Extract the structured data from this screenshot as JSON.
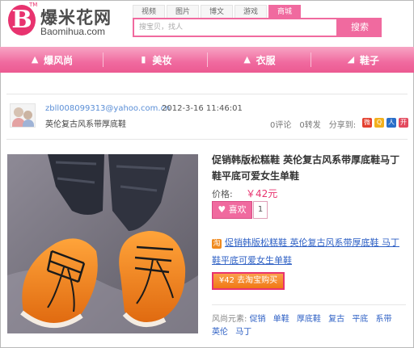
{
  "site": {
    "logo_letter": "B",
    "logo_cn": "爆米花网",
    "logo_en": "Baomihua.com"
  },
  "search": {
    "tabs": [
      {
        "label": "视频",
        "active": false
      },
      {
        "label": "图片",
        "active": false
      },
      {
        "label": "博文",
        "active": false
      },
      {
        "label": "游戏",
        "active": false
      },
      {
        "label": "商城",
        "active": true
      }
    ],
    "placeholder": "搜宝贝，找人",
    "button_label": "搜索"
  },
  "nav": {
    "items": [
      {
        "label": "爆风尚",
        "icon": "hat-icon"
      },
      {
        "label": "美妆",
        "icon": "cosmetics-icon"
      },
      {
        "label": "衣服",
        "icon": "shirt-icon"
      },
      {
        "label": "鞋子",
        "icon": "shoe-icon"
      }
    ]
  },
  "post": {
    "author": "zbll008099313@yahoo.com.cn",
    "time": "2012-3-16 11:46:01",
    "subtitle": "英伦复古风系带厚底鞋",
    "comments": "0评论",
    "reposts": "0转发",
    "share_label": "分享到:",
    "share_icons": [
      "weibo-icon",
      "qzone-icon",
      "renren-icon",
      "kaixin-icon"
    ]
  },
  "product": {
    "title": "促销韩版松糕鞋 英伦复古风系带厚底鞋马丁鞋平底可爱女生单鞋",
    "price_label": "价格:",
    "price": "￥42元",
    "like_label": "喜欢",
    "like_count": "1",
    "link_text": "促销韩版松糕鞋 英伦复古风系带厚底鞋 马丁鞋平底可爱女生单鞋",
    "buy_label": "¥42 去淘宝购买",
    "tags_label": "风尚元素:",
    "tags": [
      "促销",
      "单鞋",
      "厚底鞋",
      "复古",
      "平底",
      "系带",
      "英伦",
      "马丁"
    ]
  },
  "colors": {
    "brand_pink": "#f06a9f",
    "logo_pink": "#e8336f",
    "link_blue": "#2f61c5",
    "buy_orange": "#f07814"
  }
}
